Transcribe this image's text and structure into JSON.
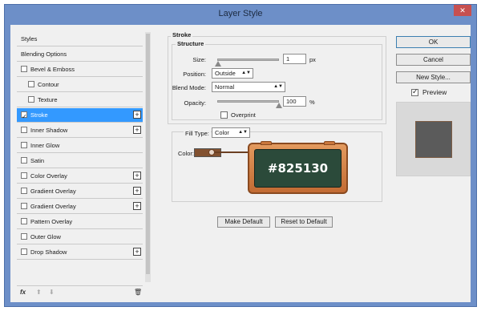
{
  "window": {
    "title": "Layer Style",
    "close_glyph": "✕"
  },
  "sidebar": {
    "items": [
      {
        "label": "Styles",
        "checkbox": false,
        "checked": false,
        "plus": false,
        "indent": false,
        "selected": false
      },
      {
        "label": "Blending Options",
        "checkbox": false,
        "checked": false,
        "plus": false,
        "indent": false,
        "selected": false
      },
      {
        "label": "Bevel & Emboss",
        "checkbox": true,
        "checked": false,
        "plus": false,
        "indent": false,
        "selected": false
      },
      {
        "label": "Contour",
        "checkbox": true,
        "checked": false,
        "plus": false,
        "indent": true,
        "selected": false
      },
      {
        "label": "Texture",
        "checkbox": true,
        "checked": false,
        "plus": false,
        "indent": true,
        "selected": false
      },
      {
        "label": "Stroke",
        "checkbox": true,
        "checked": true,
        "plus": true,
        "indent": false,
        "selected": true
      },
      {
        "label": "Inner Shadow",
        "checkbox": true,
        "checked": false,
        "plus": true,
        "indent": false,
        "selected": false
      },
      {
        "label": "Inner Glow",
        "checkbox": true,
        "checked": false,
        "plus": false,
        "indent": false,
        "selected": false
      },
      {
        "label": "Satin",
        "checkbox": true,
        "checked": false,
        "plus": false,
        "indent": false,
        "selected": false
      },
      {
        "label": "Color Overlay",
        "checkbox": true,
        "checked": false,
        "plus": true,
        "indent": false,
        "selected": false
      },
      {
        "label": "Gradient Overlay",
        "checkbox": true,
        "checked": false,
        "plus": true,
        "indent": false,
        "selected": false
      },
      {
        "label": "Gradient Overlay",
        "checkbox": true,
        "checked": false,
        "plus": true,
        "indent": false,
        "selected": false
      },
      {
        "label": "Pattern Overlay",
        "checkbox": true,
        "checked": false,
        "plus": false,
        "indent": false,
        "selected": false
      },
      {
        "label": "Outer Glow",
        "checkbox": true,
        "checked": false,
        "plus": false,
        "indent": false,
        "selected": false
      },
      {
        "label": "Drop Shadow",
        "checkbox": true,
        "checked": false,
        "plus": true,
        "indent": false,
        "selected": false
      }
    ],
    "toolbar": {
      "fx_label": "fx",
      "up_glyph": "⬆",
      "down_glyph": "⬇",
      "trash_glyph": "🗑"
    }
  },
  "stroke": {
    "group_title": "Stroke",
    "structure_title": "Structure",
    "size_label": "Size:",
    "size_value": "1",
    "size_unit": "px",
    "position_label": "Position:",
    "position_value": "Outside",
    "blend_label": "Blend Mode:",
    "blend_value": "Normal",
    "opacity_label": "Opacity:",
    "opacity_value": "100",
    "opacity_unit": "%",
    "overprint_label": "Overprint",
    "filltype_label": "Fill Type:",
    "filltype_value": "Color",
    "color_label": "Color:",
    "color_hex": "#825130",
    "badge_text": "#825130",
    "make_default": "Make Default",
    "reset_default": "Reset to Default"
  },
  "actions": {
    "ok": "OK",
    "cancel": "Cancel",
    "new_style": "New Style...",
    "preview_label": "Preview",
    "preview_checked": true
  },
  "colors": {
    "selected_row": "#3399ff",
    "titlebar": "#6d8fc8",
    "stroke_color": "#825130"
  }
}
